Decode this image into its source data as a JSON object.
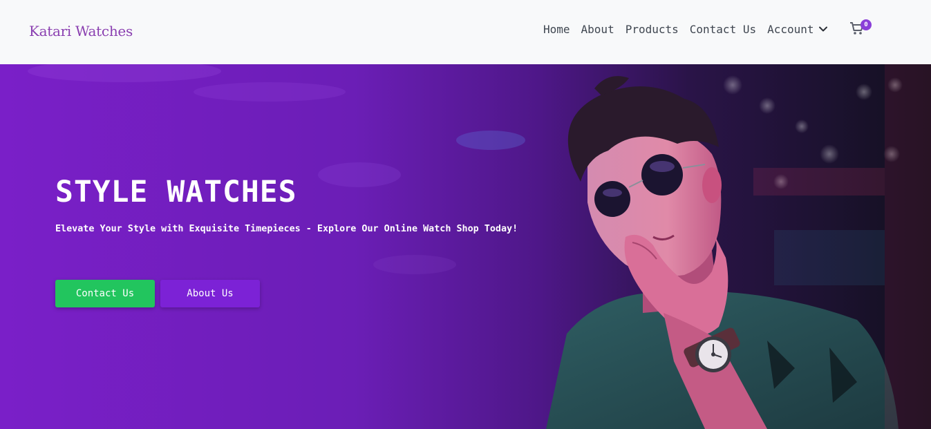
{
  "brand": {
    "name": "Katari Watches",
    "color": "#8a3fb0"
  },
  "nav": {
    "items": [
      {
        "label": "Home"
      },
      {
        "label": "About"
      },
      {
        "label": "Products"
      },
      {
        "label": "Contact Us"
      }
    ],
    "account_label": "Account",
    "account_icon": "chevron-down-icon",
    "cart_icon": "shopping-cart-icon",
    "cart_count": "0"
  },
  "hero": {
    "title": "STYLE WATCHES",
    "subtitle": "Elevate Your Style with Exquisite Timepieces - Explore Our Online Watch Shop Today!",
    "buttons": {
      "contact_label": "Contact Us",
      "about_label": "About Us"
    },
    "image": "man-with-sunglasses-and-wristwatch-photo"
  },
  "colors": {
    "navbar_bg": "#f8f9fa",
    "hero_gradient_start": "#7a1fc8",
    "hero_gradient_end": "#12101e",
    "contact_button": "#22c55e",
    "about_button": "#7c22d6",
    "cart_badge": "#8a3fd8"
  }
}
